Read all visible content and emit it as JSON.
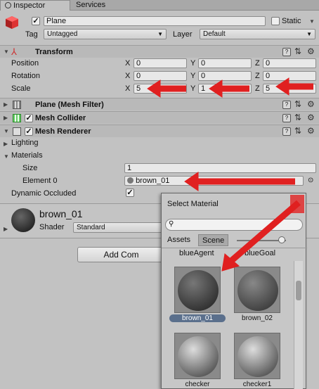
{
  "tabs": {
    "inspector": "Inspector",
    "services": "Services"
  },
  "object": {
    "name": "Plane",
    "static_label": "Static",
    "tag_label": "Tag",
    "tag_value": "Untagged",
    "layer_label": "Layer",
    "layer_value": "Default"
  },
  "transform": {
    "title": "Transform",
    "rows": [
      {
        "label": "Position",
        "x": "0",
        "y": "0",
        "z": "0"
      },
      {
        "label": "Rotation",
        "x": "0",
        "y": "0",
        "z": "0"
      },
      {
        "label": "Scale",
        "x": "5",
        "y": "1",
        "z": "5"
      }
    ],
    "axis_x": "X",
    "axis_y": "Y",
    "axis_z": "Z"
  },
  "components": {
    "mesh_filter": "Plane (Mesh Filter)",
    "mesh_collider": "Mesh Collider",
    "mesh_renderer": "Mesh Renderer"
  },
  "renderer": {
    "lighting": "Lighting",
    "materials": "Materials",
    "size_label": "Size",
    "size_value": "1",
    "element_label": "Element 0",
    "element_value": "brown_01",
    "dynamic_occluded": "Dynamic Occluded"
  },
  "material": {
    "name": "brown_01",
    "shader_label": "Shader",
    "shader_value": "Standard"
  },
  "add_component": "Add Com",
  "popup": {
    "title": "Select Material",
    "tab_assets": "Assets",
    "tab_scene": "Scene",
    "row1": [
      "blueAgent",
      "blueGoal"
    ],
    "items": [
      "brown_01",
      "brown_02",
      "checker",
      "checker1"
    ]
  },
  "colors": {
    "accent_red": "#e02020",
    "selected": "#5a6f8c"
  }
}
